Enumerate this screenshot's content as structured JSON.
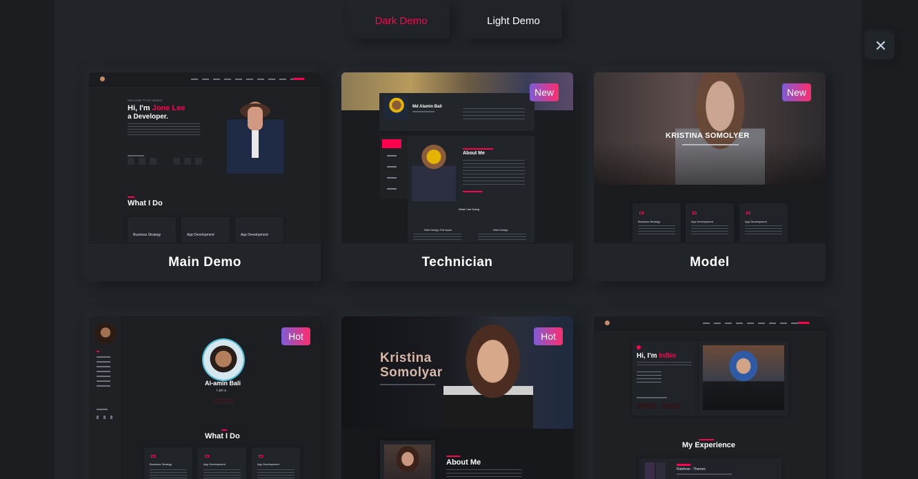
{
  "tabs": {
    "dark": "Dark Demo",
    "light": "Light Demo"
  },
  "close_icon": "close-icon",
  "demos": [
    {
      "title": "Main Demo",
      "badge": "",
      "hero_small": "WELCOME TO MY WORLD",
      "hero_line1": "Hi, I'm ",
      "hero_name": "Jone Lee",
      "hero_line2": "a Developer.",
      "section": "What I Do",
      "services": [
        "Business Strategy",
        "App Development",
        "App Development"
      ]
    },
    {
      "title": "Technician",
      "badge": "New",
      "profile_name": "Md Alamin Bali",
      "about": "About Me",
      "section": "What I am Doing",
      "services": [
        "Web Design Full stack",
        "Web Design"
      ]
    },
    {
      "title": "Model",
      "badge": "New",
      "hero_name": "KRISTINA SOMOLYER",
      "services": [
        "Business Strategy",
        "App Development",
        "App Development"
      ]
    },
    {
      "title": "",
      "badge": "Hot",
      "profile_name": "Al-amin Bali",
      "subtitle": "I am a",
      "section": "What I Do",
      "services": [
        "Business Strategy",
        "App Development",
        "App Development"
      ]
    },
    {
      "title": "",
      "badge": "Hot",
      "hero_first": "Kristina",
      "hero_last": "Somolyar",
      "about": "About Me"
    },
    {
      "title": "",
      "badge": "",
      "hero_line1": "Hi, I'm ",
      "hero_name": "InBio",
      "section": "My Experience",
      "job": "Rainbow - Themes"
    }
  ],
  "colors": {
    "accent": "#ff014f",
    "bg": "#212428",
    "badge_from": "#7d5cd6",
    "badge_to": "#ff2d6d"
  }
}
